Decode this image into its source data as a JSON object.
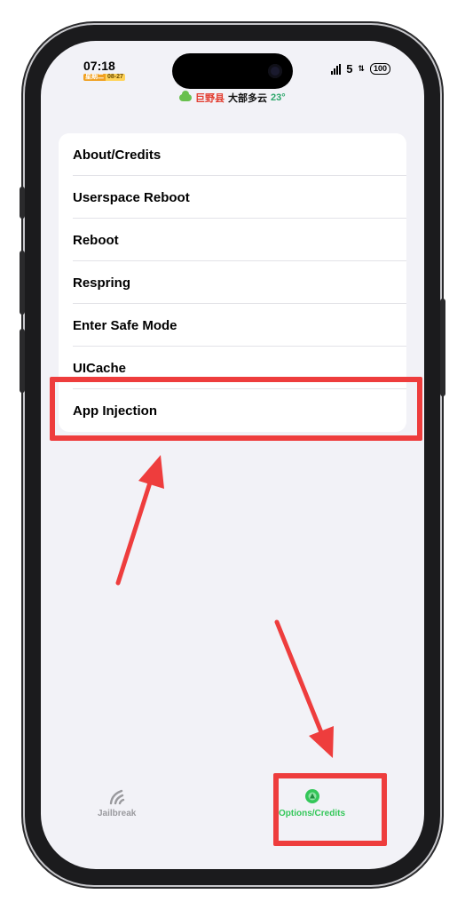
{
  "status_bar": {
    "time": "07:18",
    "date_chip_day": "星期二",
    "date_chip_date": "08-27",
    "signal_text": "5",
    "battery": "100",
    "weather": {
      "place": "巨野县",
      "condition": "大部多云",
      "temperature": "23°"
    }
  },
  "menu": {
    "items": [
      {
        "label": "About/Credits"
      },
      {
        "label": "Userspace Reboot"
      },
      {
        "label": "Reboot"
      },
      {
        "label": "Respring"
      },
      {
        "label": "Enter Safe Mode"
      },
      {
        "label": "UICache"
      },
      {
        "label": "App Injection"
      }
    ]
  },
  "tab_bar": {
    "tabs": [
      {
        "label": "Jailbreak",
        "icon": "antenna-icon",
        "active": false
      },
      {
        "label": "Options/Credits",
        "icon": "options-gear-icon",
        "active": true
      }
    ]
  },
  "colors": {
    "accent": "#34c759",
    "annotation": "#ee3d3d",
    "inactive_tab": "#9a9a9e",
    "screen_background": "#f2f2f7"
  }
}
